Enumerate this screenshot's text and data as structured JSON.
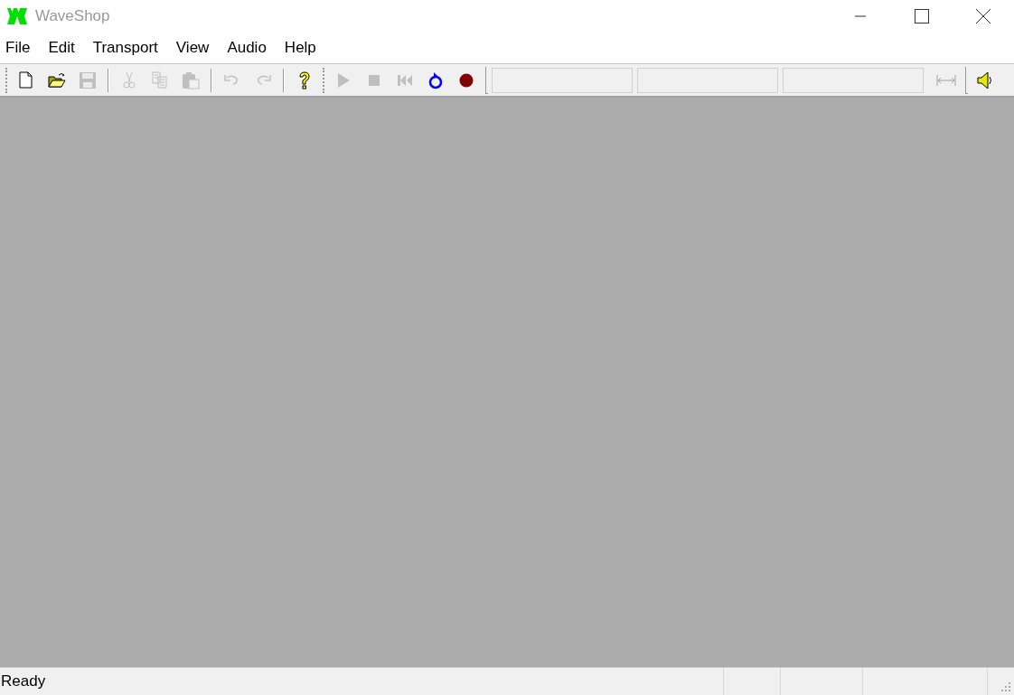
{
  "window": {
    "title": "WaveShop"
  },
  "menu": [
    "File",
    "Edit",
    "Transport",
    "View",
    "Audio",
    "Help"
  ],
  "toolbar_groups": [
    {
      "items": [
        {
          "kind": "new",
          "disabled": false
        },
        {
          "kind": "open",
          "disabled": false
        },
        {
          "kind": "save",
          "disabled": true
        },
        {
          "kind": "cut",
          "disabled": true
        },
        {
          "kind": "copy",
          "disabled": true
        },
        {
          "kind": "paste",
          "disabled": true
        },
        {
          "kind": "undo",
          "disabled": true
        },
        {
          "kind": "redo",
          "disabled": true
        },
        {
          "kind": "help",
          "disabled": false
        }
      ]
    },
    {
      "items": [
        {
          "kind": "play",
          "disabled": true
        },
        {
          "kind": "stop",
          "disabled": true
        },
        {
          "kind": "rewind",
          "disabled": true
        },
        {
          "kind": "loop",
          "disabled": false
        },
        {
          "kind": "record",
          "disabled": false
        }
      ]
    }
  ],
  "zoom_button": {
    "disabled": true
  },
  "volume_button": {
    "disabled": false
  },
  "status_bar": {
    "text": "Ready"
  }
}
